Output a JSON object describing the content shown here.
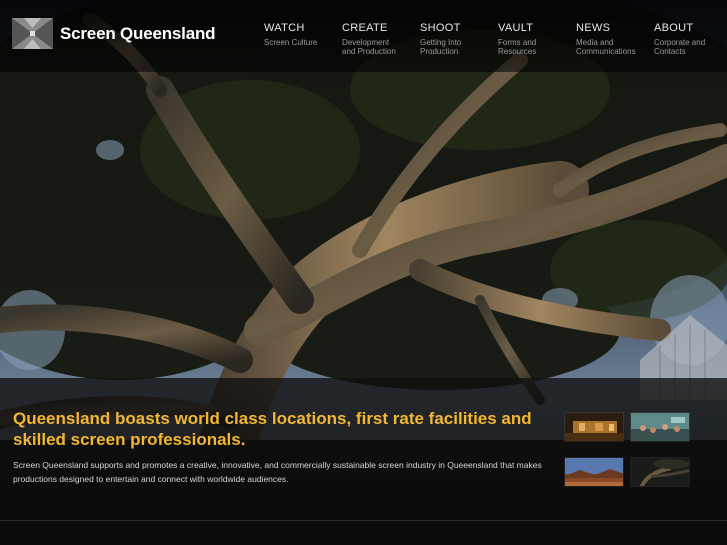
{
  "brand": {
    "name": "Screen Queensland"
  },
  "nav": [
    {
      "title": "WATCH",
      "sub": "Screen Culture"
    },
    {
      "title": "CREATE",
      "sub": "Development\nand Production"
    },
    {
      "title": "SHOOT",
      "sub": "Getting Into\nProduction"
    },
    {
      "title": "VAULT",
      "sub": "Forms and\nResources"
    },
    {
      "title": "NEWS",
      "sub": "Media and\nCommunications"
    },
    {
      "title": "ABOUT",
      "sub": "Corporate and\nContacts"
    }
  ],
  "feature": {
    "headline": "Queensland boasts world class locations, first rate facilities and skilled screen professionals.",
    "blurb": "Screen Queensland supports and promotes a creative, innovative, and commercially sustainable screen industry in Queeensland that makes productions designed to entertain and connect with worldwide audiences."
  },
  "colors": {
    "accent": "#f2b632",
    "background": "#0b0b0b"
  }
}
